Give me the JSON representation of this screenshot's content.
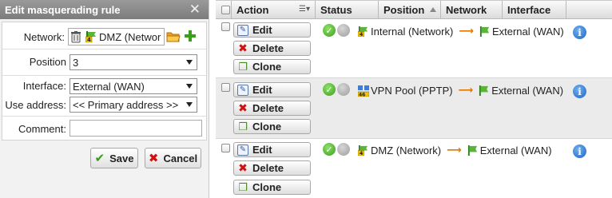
{
  "dialog": {
    "title": "Edit masquerading rule",
    "close_glyph": "✕",
    "network_label": "Network:",
    "network_value": "DMZ (Networ",
    "position_label": "Position",
    "position_value": "3",
    "interface_label": "Interface:",
    "interface_value": "External (WAN)",
    "use_address_label": "Use address:",
    "use_address_value": "<< Primary address >>",
    "comment_label": "Comment:",
    "comment_value": "",
    "save_label": "Save",
    "cancel_label": "Cancel"
  },
  "table": {
    "headers": {
      "action": "Action",
      "status": "Status",
      "position": "Position",
      "network": "Network",
      "interface": "Interface"
    },
    "button_labels": {
      "edit": "Edit",
      "delete": "Delete",
      "clone": "Clone"
    },
    "rows": [
      {
        "source": "Internal (Network)",
        "source_icon": "network-badge-4-icon",
        "target": "External (WAN)",
        "status": "enabled"
      },
      {
        "source": "VPN Pool (PPTP)",
        "source_icon": "vpn-pool-icon",
        "target": "External (WAN)",
        "status": "enabled"
      },
      {
        "source": "DMZ (Network)",
        "source_icon": "network-badge-4-icon",
        "target": "External (WAN)",
        "status": "enabled"
      }
    ],
    "arrow_glyph": "⟶"
  },
  "colors": {
    "title_bar": "#8a8a8a",
    "arrow": "#e07800",
    "status_green": "#3b9e1c",
    "info_blue": "#1c64c4",
    "alt_row": "#ebebeb"
  }
}
